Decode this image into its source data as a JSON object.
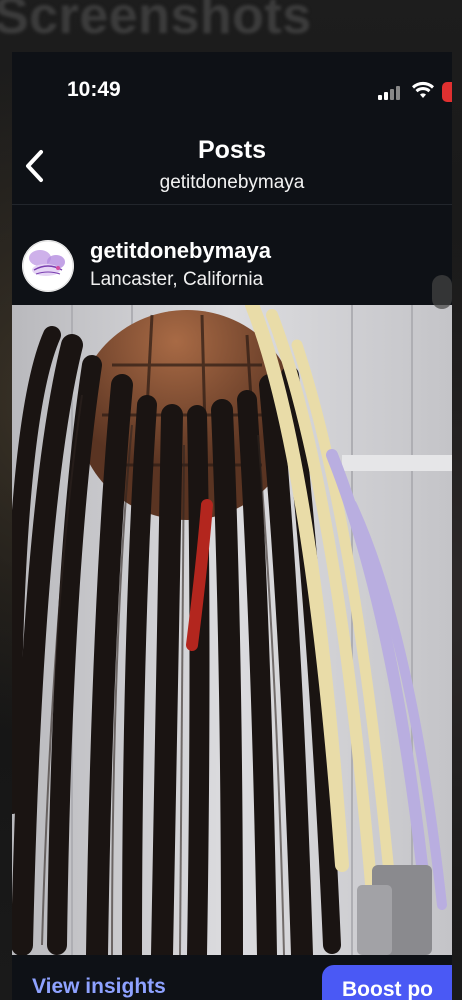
{
  "background": {
    "title": "Screenshots"
  },
  "status_bar": {
    "time": "10:49"
  },
  "nav": {
    "title": "Posts",
    "subtitle": "getitdonebymaya",
    "back_icon": "chevron-left-icon"
  },
  "post": {
    "username": "getitdonebymaya",
    "location": "Lancaster, California",
    "avatar_icon": "profile-logo-icon",
    "image_description_icon": "photo"
  },
  "actions": {
    "insights_label": "View insights",
    "boost_label": "Boost po"
  },
  "colors": {
    "accent": "#4a59f5",
    "link": "#8ea2ff",
    "background": "#0e1116",
    "battery": "#e03030"
  }
}
